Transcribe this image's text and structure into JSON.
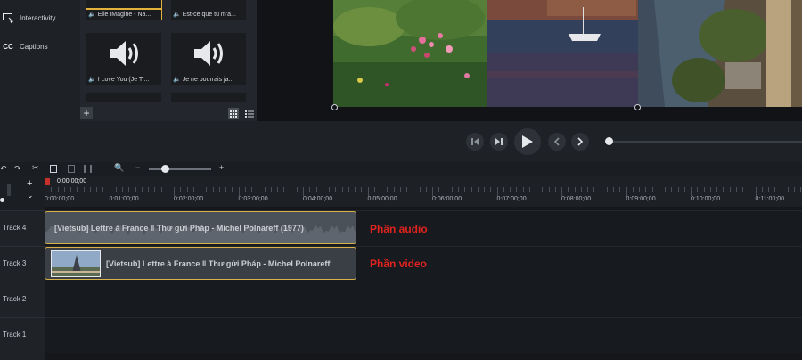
{
  "sidebar": {
    "items": [
      {
        "label": "Interactivity",
        "icon": "interactivity-icon"
      },
      {
        "label": "Captions",
        "icon_text": "CC"
      }
    ]
  },
  "media_bin": {
    "tiles": [
      {
        "caption": "Elle IMagine - Na...",
        "selected": true
      },
      {
        "caption": "Est-ce que tu m'a...",
        "selected": false
      },
      {
        "caption": "I Love You (Je T'...",
        "selected": false
      },
      {
        "caption": "Je ne pourrais ja...",
        "selected": false
      }
    ]
  },
  "timeline": {
    "playhead_time": "0:00:00;00",
    "ruler_labels": [
      "0:00:00;00",
      "0:01:00;00",
      "0:02:00;00",
      "0:03:00;00",
      "0:04:00;00",
      "0:05:00;00",
      "0:06:00;00",
      "0:07:00;00",
      "0:08:00;00",
      "0:09:00;00",
      "0:10:00;00",
      "0:11:00;00"
    ],
    "tracks": [
      {
        "name": "Track 4"
      },
      {
        "name": "Track 3"
      },
      {
        "name": "Track 2"
      },
      {
        "name": "Track 1"
      }
    ],
    "audio_clip_label": "[Vietsub] Lettre à France ‖ Thư gửi Pháp - Michel Polnareff (1977)",
    "video_clip_label": "[Vietsub] Lettre à France ‖ Thư gửi Pháp - Michel Polnareff"
  },
  "annotations": {
    "audio": "Phần audio",
    "video": "Phần video"
  },
  "colors": {
    "clip_border": "#d8b14a",
    "annotation_red": "#e0231f",
    "playhead_red": "#c8302c"
  }
}
